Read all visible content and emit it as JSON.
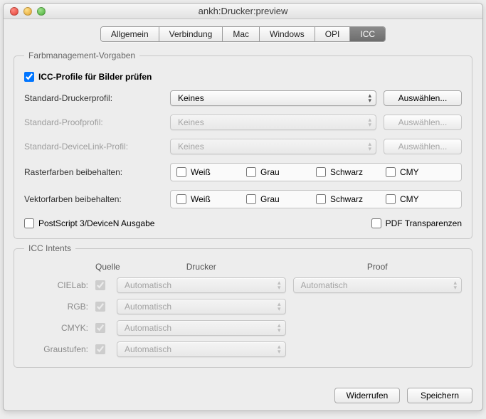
{
  "window": {
    "title": "ankh:Drucker:preview"
  },
  "tabs": {
    "items": [
      "Allgemein",
      "Verbindung",
      "Mac",
      "Windows",
      "OPI",
      "ICC"
    ],
    "active": 5
  },
  "fm": {
    "legend": "Farbmanagement-Vorgaben",
    "checkProfiles": {
      "label": "ICC-Profile für Bilder prüfen",
      "checked": true
    },
    "rows": {
      "printer": {
        "label": "Standard-Druckerprofil:",
        "value": "Keines",
        "btn": "Auswählen...",
        "enabled": true
      },
      "proof": {
        "label": "Standard-Proofprofil:",
        "value": "Keines",
        "btn": "Auswählen...",
        "enabled": false
      },
      "device": {
        "label": "Standard-DeviceLink-Profil:",
        "value": "Keines",
        "btn": "Auswählen...",
        "enabled": false
      }
    },
    "rasterLabel": "Rasterfarben beibehalten:",
    "vectorLabel": "Vektorfarben beibehalten:",
    "colorOpts": {
      "white": "Weiß",
      "gray": "Grau",
      "black": "Schwarz",
      "cmy": "CMY"
    },
    "ps3": "PostScript 3/DeviceN Ausgabe",
    "pdftrans": "PDF Transparenzen"
  },
  "intents": {
    "legend": "ICC Intents",
    "col_source": "Quelle",
    "col_printer": "Drucker",
    "col_proof": "Proof",
    "rows": {
      "cielab": {
        "label": "CIELab:",
        "printer": "Automatisch",
        "proof": "Automatisch"
      },
      "rgb": {
        "label": "RGB:",
        "printer": "Automatisch"
      },
      "cmyk": {
        "label": "CMYK:",
        "printer": "Automatisch"
      },
      "gray": {
        "label": "Graustufen:",
        "printer": "Automatisch"
      }
    }
  },
  "footer": {
    "revert": "Widerrufen",
    "save": "Speichern"
  }
}
